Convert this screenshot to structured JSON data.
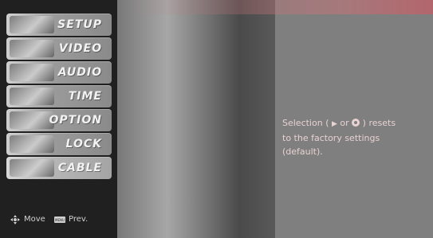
{
  "menu": {
    "items": [
      {
        "label": "SETUP",
        "thumb_icon": "setup-thumbnail"
      },
      {
        "label": "VIDEO",
        "thumb_icon": "video-thumbnail"
      },
      {
        "label": "AUDIO",
        "thumb_icon": "audio-thumbnail"
      },
      {
        "label": "TIME",
        "thumb_icon": "time-thumbnail"
      },
      {
        "label": "OPTION",
        "thumb_icon": "option-thumbnail"
      },
      {
        "label": "LOCK",
        "thumb_icon": "lock-thumbnail"
      },
      {
        "label": "CABLE",
        "thumb_icon": "cable-thumbnail"
      }
    ],
    "selected_index": 6
  },
  "hints": {
    "move_label": "Move",
    "prev_button_text": "MENU",
    "prev_label": "Prev."
  },
  "info_panel": {
    "line1_prefix": "Selection (",
    "arrow": "▶",
    "or": "or",
    "line1_suffix": ") resets",
    "line2": "to the factory settings",
    "line3": "(default)."
  },
  "colors": {
    "panel_bg": "#7f7f7f",
    "info_text": "#e8d2d2",
    "menu_label": "#f2f2f2",
    "sidebar_bg": "#202020"
  }
}
